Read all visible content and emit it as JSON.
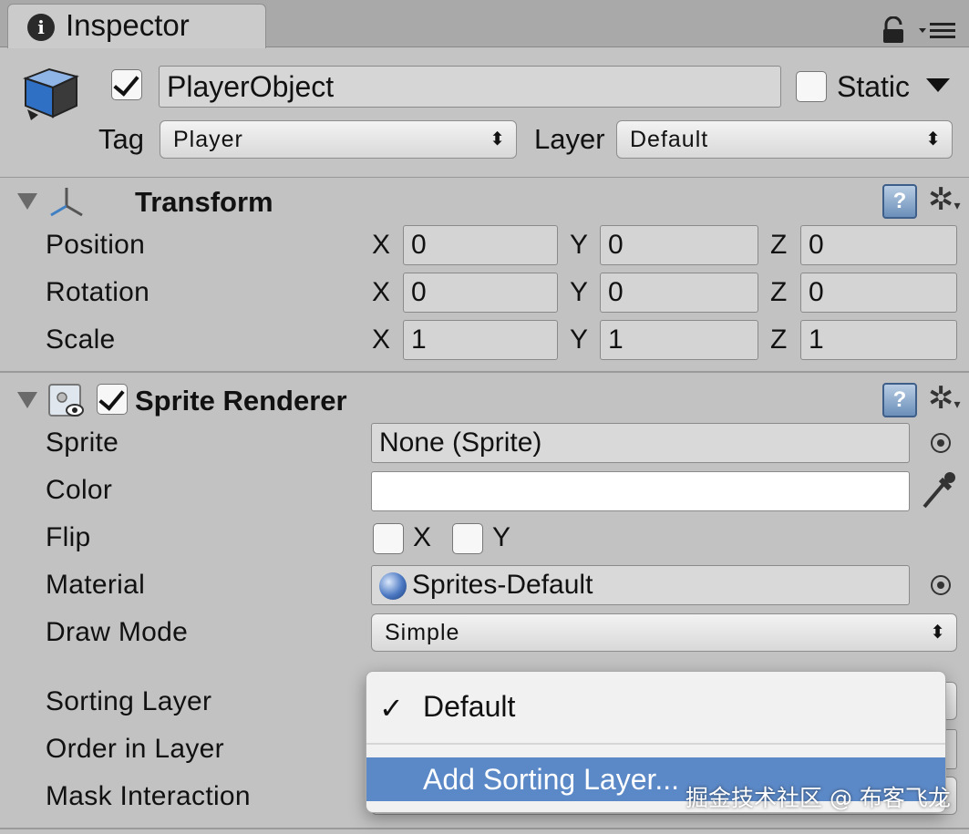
{
  "tab": {
    "title": "Inspector",
    "info_glyph": "i",
    "icons": [
      "lock-icon",
      "menu-icon"
    ]
  },
  "object": {
    "active": true,
    "name": "PlayerObject",
    "static_checked": false,
    "static_label": "Static",
    "tag_label": "Tag",
    "tag_value": "Player",
    "layer_label": "Layer",
    "layer_value": "Default",
    "popup_arrows": "⬍"
  },
  "transform": {
    "title": "Transform",
    "rows": [
      {
        "label": "Position",
        "x": "0",
        "y": "0",
        "z": "0"
      },
      {
        "label": "Rotation",
        "x": "0",
        "y": "0",
        "z": "0"
      },
      {
        "label": "Scale",
        "x": "1",
        "y": "1",
        "z": "1"
      }
    ],
    "axes": {
      "x": "X",
      "y": "Y",
      "z": "Z"
    }
  },
  "sprite_renderer": {
    "enabled": true,
    "title": "Sprite Renderer",
    "sprite_label": "Sprite",
    "sprite_value": "None (Sprite)",
    "color_label": "Color",
    "color_value": "#ffffff",
    "flip_label": "Flip",
    "flip_x": "X",
    "flip_y": "Y",
    "material_label": "Material",
    "material_value": "Sprites-Default",
    "draw_mode_label": "Draw Mode",
    "draw_mode_value": "Simple",
    "sorting_layer_label": "Sorting Layer",
    "order_in_layer_label": "Order in Layer",
    "mask_interaction_label": "Mask Interaction"
  },
  "help_glyph": "?",
  "gear_glyph": "✲",
  "gear_caret": "▾",
  "dropdown": {
    "check": "✓",
    "selected": "Default",
    "add_item": "Add Sorting Layer..."
  },
  "watermark": "掘金技术社区 @ 布客飞龙",
  "colors": {
    "highlight": "#5b88c6",
    "background": "#c2c2c2"
  }
}
